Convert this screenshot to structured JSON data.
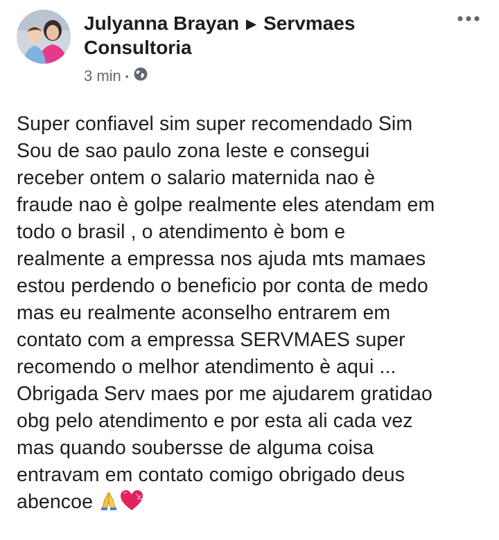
{
  "post": {
    "author": "Julyanna Brayan",
    "group": "Servmaes Consultoria",
    "timestamp": "3 min",
    "privacy_icon": "globe-icon",
    "more_icon": "more-options-icon",
    "body": "Super confiavel sim super recomendado Sim\nSou de sao paulo zona leste e consegui\nreceber ontem o salario maternida nao è\nfraude nao è golpe realmente eles atendam em\ntodo o brasil , o atendimento è bom  e\nrealmente a empressa nos ajuda mts mamaes\nestou perdendo o beneficio por conta de medo\nmas eu realmente aconselho entrarem em\ncontato com a empressa SERVMAES  super\nrecomendo o melhor atendimento è aqui ...\nObrigada Serv maes por me ajudarem gratidao\nobg pelo atendimento e por esta ali cada vez\nmas quando soubersse de alguma coisa\nentravam em contato comigo obrigado deus\nabencoe",
    "emojis": [
      "praying-hands-emoji",
      "heart-emoji"
    ]
  },
  "colors": {
    "text": "#1c1e21",
    "secondary_text": "#606770",
    "avatar_accent": "#e23b8a"
  }
}
